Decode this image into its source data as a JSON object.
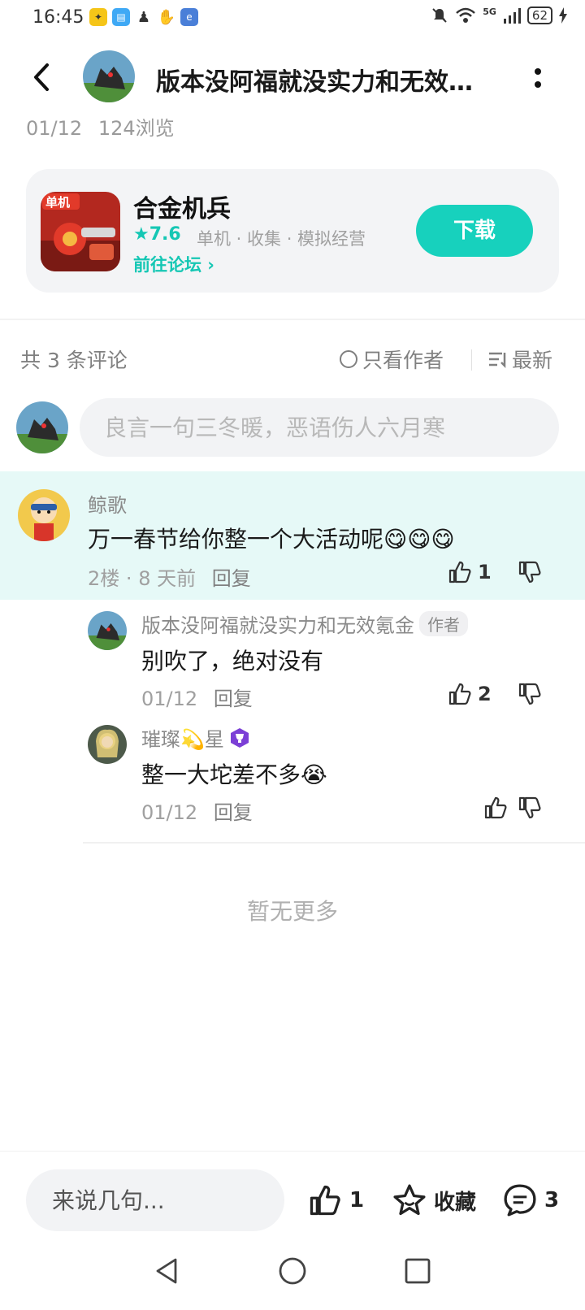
{
  "status_bar": {
    "time": "16:45",
    "signal_label": "5G",
    "battery": "62"
  },
  "header": {
    "title": "版本没阿福就没实力和无效…",
    "date": "01/12",
    "views": "124浏览"
  },
  "game_card": {
    "icon_badge": "单机",
    "name": "合金机兵",
    "rating": "★7.6",
    "tags": "单机 · 收集 · 模拟经营",
    "forum_link": "前往论坛 ›",
    "download_label": "下载"
  },
  "comments_toolbar": {
    "count_label": "共 3 条评论",
    "only_author_label": "只看作者",
    "sort_label": "最新"
  },
  "composer": {
    "placeholder": "良言一句三冬暖，恶语伤人六月寒"
  },
  "main_comment": {
    "author": "鲸歌",
    "content": "万一春节给你整一个大活动呢😋😋😋",
    "floor": "2楼",
    "time": "8 天前",
    "reply_label": "回复",
    "likes": "1"
  },
  "replies": [
    {
      "author": "版本没阿福就没实力和无效氪金",
      "badge": "作者",
      "content": "别吹了，绝对没有",
      "date": "01/12",
      "reply_label": "回复",
      "likes": "2"
    },
    {
      "author": "璀璨💫星",
      "content": "整一大坨差不多😭",
      "date": "01/12",
      "reply_label": "回复",
      "likes": ""
    }
  ],
  "footer": {
    "no_more": "暂无更多"
  },
  "bottom_bar": {
    "input_placeholder": "来说几句...",
    "like_count": "1",
    "favorite_label": "收藏",
    "comment_count": "3"
  },
  "colors": {
    "accent": "#17d1bd",
    "highlight_bg": "#e6f9f7",
    "card_bg": "#f3f4f6"
  }
}
